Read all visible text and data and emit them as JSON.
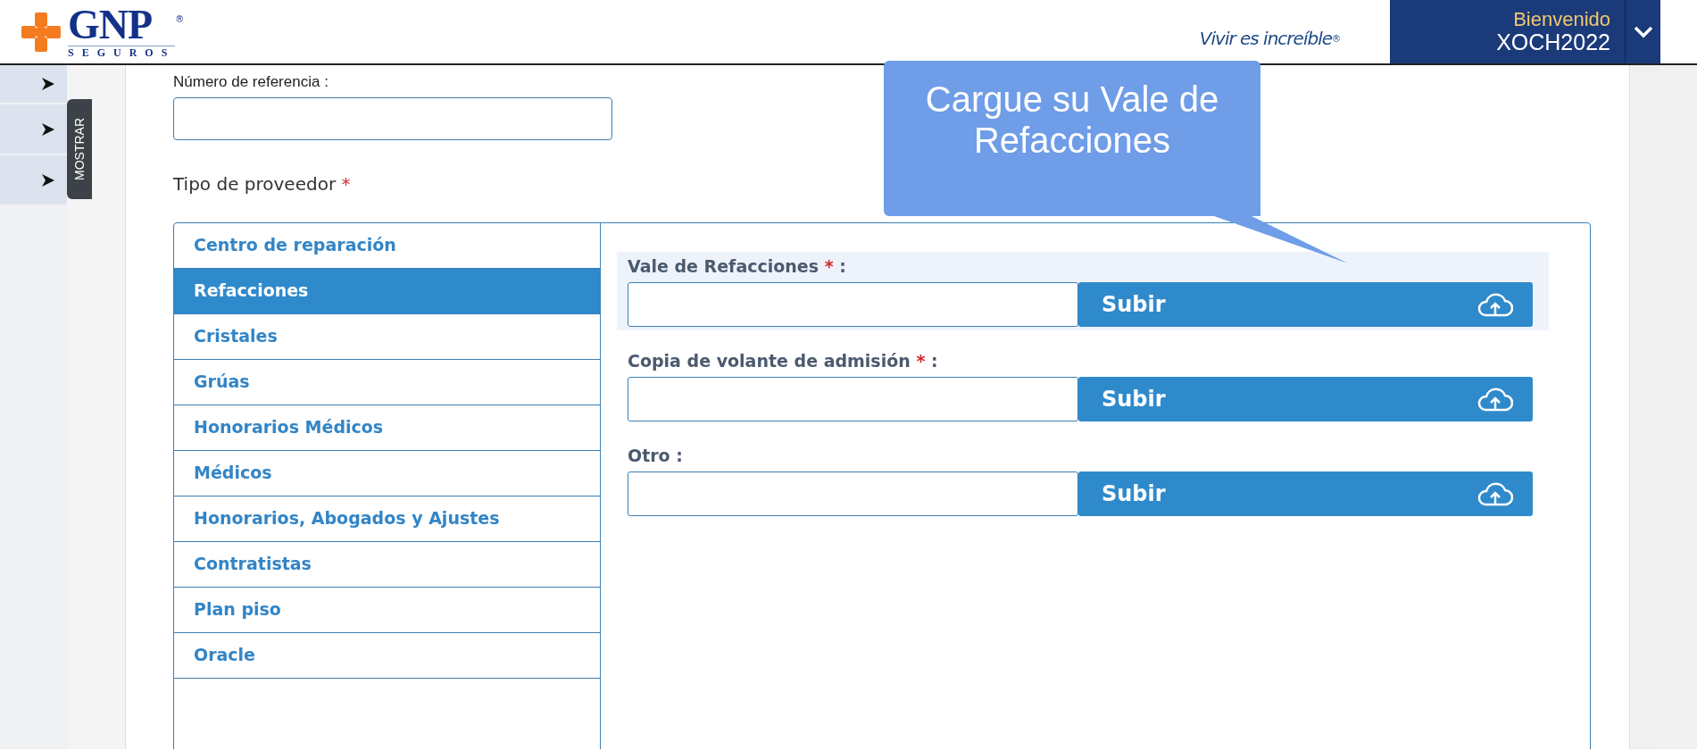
{
  "header": {
    "logo": {
      "name": "GNP",
      "registered": "®",
      "subtitle": "SEGUROS"
    },
    "slogan": {
      "text": "Vivir es increíble",
      "registered": "®"
    },
    "user": {
      "greeting": "Bienvenido",
      "username": "XOCH2022"
    }
  },
  "sidebar": {
    "toggle_label": "MOSTRAR"
  },
  "form": {
    "reference": {
      "label": "Número de referencia :"
    },
    "provider_type": {
      "label": "Tipo de proveedor",
      "required_mark": "*"
    },
    "provider_types": [
      {
        "label": "Centro de reparación",
        "selected": false
      },
      {
        "label": "Refacciones",
        "selected": true
      },
      {
        "label": "Cristales",
        "selected": false
      },
      {
        "label": "Grúas",
        "selected": false
      },
      {
        "label": "Honorarios Médicos",
        "selected": false
      },
      {
        "label": "Médicos",
        "selected": false
      },
      {
        "label": "Honorarios, Abogados y Ajustes",
        "selected": false
      },
      {
        "label": "Contratistas",
        "selected": false
      },
      {
        "label": "Plan piso",
        "selected": false
      },
      {
        "label": "Oracle",
        "selected": false
      }
    ],
    "uploads": [
      {
        "label": "Vale de Refacciones",
        "required_mark": "*",
        "colon": ":",
        "button": "Subir",
        "highlighted": true
      },
      {
        "label": "Copia de volante de admisión",
        "required_mark": "*",
        "colon": ":",
        "button": "Subir",
        "highlighted": false
      },
      {
        "label": "Otro",
        "colon": ":",
        "button": "Subir",
        "highlighted": false
      }
    ]
  },
  "callout": {
    "text": "Cargue su Vale de Refacciones"
  }
}
